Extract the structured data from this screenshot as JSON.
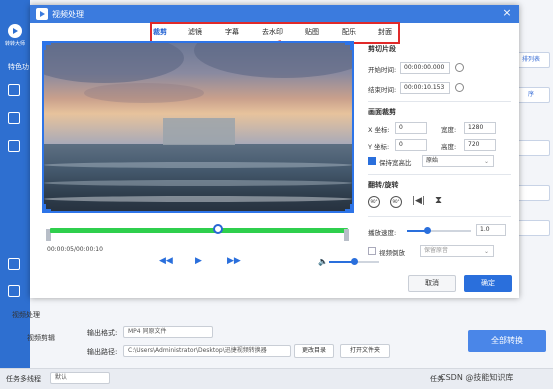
{
  "app": {
    "logo_text": "转转大师",
    "sidebar_label": "特色功",
    "right_buttons": [
      "排列表",
      "序"
    ],
    "bottom": {
      "section_title": "视频处理",
      "side_item": "视频剪辑",
      "output_format_label": "输出格式:",
      "output_format_value": "MP4 同原文件",
      "output_dir_label": "输出路径:",
      "output_dir_value": "C:\\Users\\Administrator\\Desktop\\迅捷视频转换器",
      "change_dir_button": "更改目录",
      "open_folder_button": "打开文件夹",
      "convert_all_button": "全部转换",
      "multitask_label": "任务多线程",
      "multitask_value": "默认",
      "task_label": "任务",
      "watermark": "CSDN @技能知识库"
    }
  },
  "modal": {
    "title": "视频处理",
    "close_label": "×",
    "tabs": [
      {
        "label": "裁剪",
        "active": true
      },
      {
        "label": "滤镜",
        "active": false
      },
      {
        "label": "字幕",
        "active": false
      },
      {
        "label": "去水印",
        "active": false
      },
      {
        "label": "贴图",
        "active": false
      },
      {
        "label": "配乐",
        "active": false
      },
      {
        "label": "封面",
        "active": false
      }
    ],
    "player": {
      "timecode": "00:00:05/00:00:10",
      "progress": 0.5
    },
    "clip": {
      "title": "剪切片段",
      "start_label": "开始时间:",
      "start_value": "00:00:00.000",
      "end_label": "结束时间:",
      "end_value": "00:00:10.153"
    },
    "crop": {
      "title": "画面裁剪",
      "x_label": "X 坐标:",
      "x_value": "0",
      "width_label": "宽度:",
      "width_value": "1280",
      "y_label": "Y 坐标:",
      "y_value": "0",
      "height_label": "高度:",
      "height_value": "720",
      "keep_ratio_label": "保持宽高比",
      "keep_ratio_checked": true,
      "ratio_value": "原始"
    },
    "rotate": {
      "title": "翻转/旋转",
      "rotate_left": "90°",
      "rotate_right": "90°"
    },
    "speed": {
      "label": "播放速度:",
      "value": "1.0",
      "level": 0.3
    },
    "reverse": {
      "label": "视频倒放",
      "checked": false,
      "select_value": "保留原音"
    },
    "buttons": {
      "cancel": "取消",
      "ok": "确定"
    }
  },
  "colors": {
    "accent": "#2a6fdc",
    "highlight_box": "#e02a2a",
    "timeline": "#2fcf4d"
  }
}
